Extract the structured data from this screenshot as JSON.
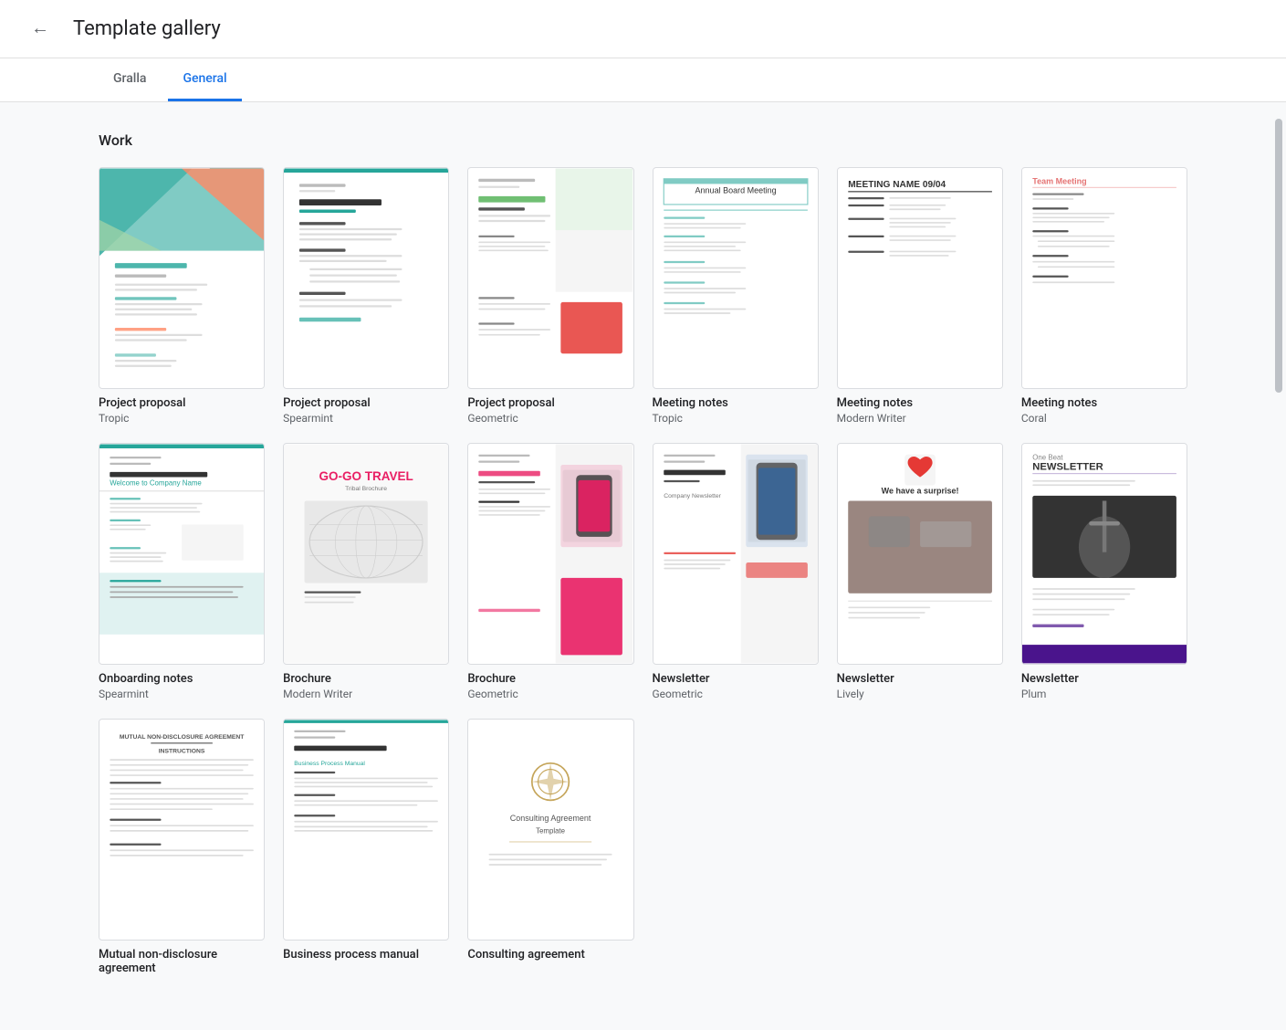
{
  "header": {
    "back_label": "←",
    "title": "Template gallery"
  },
  "tabs": [
    {
      "id": "gralla",
      "label": "Gralla",
      "active": false
    },
    {
      "id": "general",
      "label": "General",
      "active": true
    }
  ],
  "section": {
    "title": "Work"
  },
  "templates": [
    {
      "id": "proj-prop-tropic",
      "name": "Project proposal",
      "subtitle": "Tropic",
      "thumb_type": "project-proposal-tropic"
    },
    {
      "id": "proj-prop-spearmint",
      "name": "Project proposal",
      "subtitle": "Spearmint",
      "thumb_type": "project-proposal-spearmint"
    },
    {
      "id": "proj-prop-geometric",
      "name": "Project proposal",
      "subtitle": "Geometric",
      "thumb_type": "project-proposal-geometric"
    },
    {
      "id": "meeting-notes-tropic",
      "name": "Meeting notes",
      "subtitle": "Tropic",
      "thumb_type": "meeting-notes-tropic"
    },
    {
      "id": "meeting-notes-modern",
      "name": "Meeting notes",
      "subtitle": "Modern Writer",
      "thumb_type": "meeting-notes-modern"
    },
    {
      "id": "meeting-notes-coral",
      "name": "Meeting notes",
      "subtitle": "Coral",
      "thumb_type": "meeting-notes-coral"
    },
    {
      "id": "onboarding-spearmint",
      "name": "Onboarding notes",
      "subtitle": "Spearmint",
      "thumb_type": "onboarding-spearmint"
    },
    {
      "id": "brochure-modern",
      "name": "Brochure",
      "subtitle": "Modern Writer",
      "thumb_type": "brochure-modern"
    },
    {
      "id": "brochure-geometric",
      "name": "Brochure",
      "subtitle": "Geometric",
      "thumb_type": "brochure-geometric"
    },
    {
      "id": "newsletter-geometric",
      "name": "Newsletter",
      "subtitle": "Geometric",
      "thumb_type": "newsletter-geometric"
    },
    {
      "id": "newsletter-lively",
      "name": "Newsletter",
      "subtitle": "Lively",
      "thumb_type": "newsletter-lively"
    },
    {
      "id": "newsletter-plum",
      "name": "Newsletter",
      "subtitle": "Plum",
      "thumb_type": "newsletter-plum"
    },
    {
      "id": "nda",
      "name": "Mutual non-disclosure agreement",
      "subtitle": "",
      "thumb_type": "nda"
    },
    {
      "id": "business-process",
      "name": "Business process manual",
      "subtitle": "",
      "thumb_type": "business-process"
    },
    {
      "id": "consulting",
      "name": "Consulting agreement",
      "subtitle": "",
      "thumb_type": "consulting"
    }
  ]
}
